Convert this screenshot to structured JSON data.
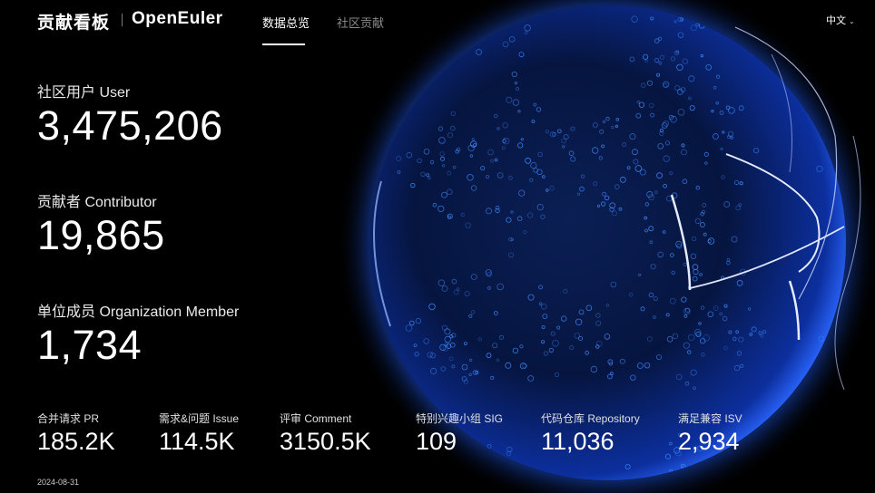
{
  "header": {
    "title": "贡献看板",
    "logo": "OpenEuler",
    "tabs": [
      {
        "label": "数据总览",
        "active": true
      },
      {
        "label": "社区贡献",
        "active": false
      }
    ],
    "language": "中文",
    "language_icon": "chevron-down-icon"
  },
  "stats": [
    {
      "label": "社区用户 User",
      "value": "3,475,206"
    },
    {
      "label": "贡献者 Contributor",
      "value": "19,865"
    },
    {
      "label": "单位成员 Organization Member",
      "value": "1,734"
    }
  ],
  "metrics": [
    {
      "label": "合并请求 PR",
      "value": "185.2K"
    },
    {
      "label": "需求&问题 Issue",
      "value": "114.5K"
    },
    {
      "label": "评审 Comment",
      "value": "3150.5K"
    },
    {
      "label": "特别兴趣小组 SIG",
      "value": "109"
    },
    {
      "label": "代码仓库 Repository",
      "value": "11,036"
    },
    {
      "label": "满足兼容 ISV",
      "value": "2,934"
    }
  ],
  "date": "2024-08-31",
  "colors": {
    "background": "#000000",
    "globe_glow": "#1e5bff",
    "globe_core": "#04102e",
    "dot": "#3f8cff",
    "text": "#ffffff",
    "muted": "#8a8a8a"
  }
}
